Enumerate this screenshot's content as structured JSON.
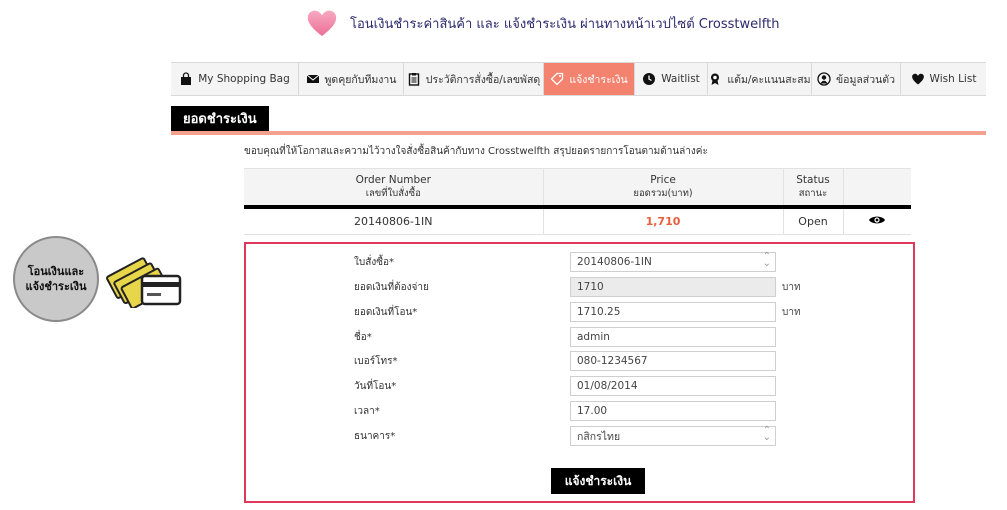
{
  "header": {
    "text": "โอนเงินชำระค่าสินค้า  และ แจ้งชำระเงิน ผ่านทางหน้าเวปไซต์ Crosstwelfth"
  },
  "nav": {
    "items": [
      {
        "label": "My Shopping Bag",
        "icon": "shopping-bag-icon"
      },
      {
        "label": "พูดคุยกับทีมงาน",
        "icon": "envelope-icon"
      },
      {
        "label": "ประวัติการสั่งซื้อ/เลขพัสดุ",
        "icon": "clipboard-icon"
      },
      {
        "label": "แจ้งชำระเงิน",
        "icon": "tag-icon",
        "active": true
      },
      {
        "label": "Waitlist",
        "icon": "clock-icon"
      },
      {
        "label": "แต้ม/คะแนนสะสม",
        "icon": "award-icon"
      },
      {
        "label": "ข้อมูลส่วนตัว",
        "icon": "user-icon"
      },
      {
        "label": "Wish List",
        "icon": "heart-icon"
      }
    ]
  },
  "section": {
    "title": "ยอดชำระเงิน",
    "intro": "ขอบคุณที่ให้โอกาสและความไว้วางใจสั่งซื้อสินค้ากับทาง  Crosstwelfth  สรุปยอดรายการโอนตามด้านล่างค่ะ"
  },
  "order_table": {
    "headers": [
      {
        "label": "Order Number",
        "sub": "เลขที่ใบสั่งซื้อ"
      },
      {
        "label": "Price",
        "sub": "ยอดรวม(บาท)"
      },
      {
        "label": "Status",
        "sub": "สถานะ"
      }
    ],
    "rows": [
      {
        "order": "20140806-1IN",
        "price": "1,710",
        "status": "Open"
      }
    ]
  },
  "form": {
    "fields": [
      {
        "label": "ใบสั่งซื้อ*",
        "value": "20140806-1IN",
        "type": "select"
      },
      {
        "label": "ยอดเงินที่ต้องจ่าย",
        "value": "1710",
        "type": "readonly",
        "unit": "บาท"
      },
      {
        "label": "ยอดเงินที่โอน*",
        "value": "1710.25",
        "type": "text",
        "unit": "บาท"
      },
      {
        "label": "ชื่อ*",
        "value": "admin",
        "type": "text"
      },
      {
        "label": "เบอร์โทร*",
        "value": "080-1234567",
        "type": "text"
      },
      {
        "label": "วันที่โอน*",
        "value": "01/08/2014",
        "type": "text"
      },
      {
        "label": "เวลา*",
        "value": "17.00",
        "type": "text"
      },
      {
        "label": "ธนาคาร*",
        "value": "กสิกรไทย",
        "type": "select"
      }
    ],
    "submit_label": "แจ้งชำระเงิน"
  },
  "badge": {
    "line1": "โอนเงินและ",
    "line2": "แจ้งชำระเงิน"
  },
  "colors": {
    "accent": "#f3826e",
    "price": "#e85d3b",
    "form_border": "#e0385a"
  }
}
